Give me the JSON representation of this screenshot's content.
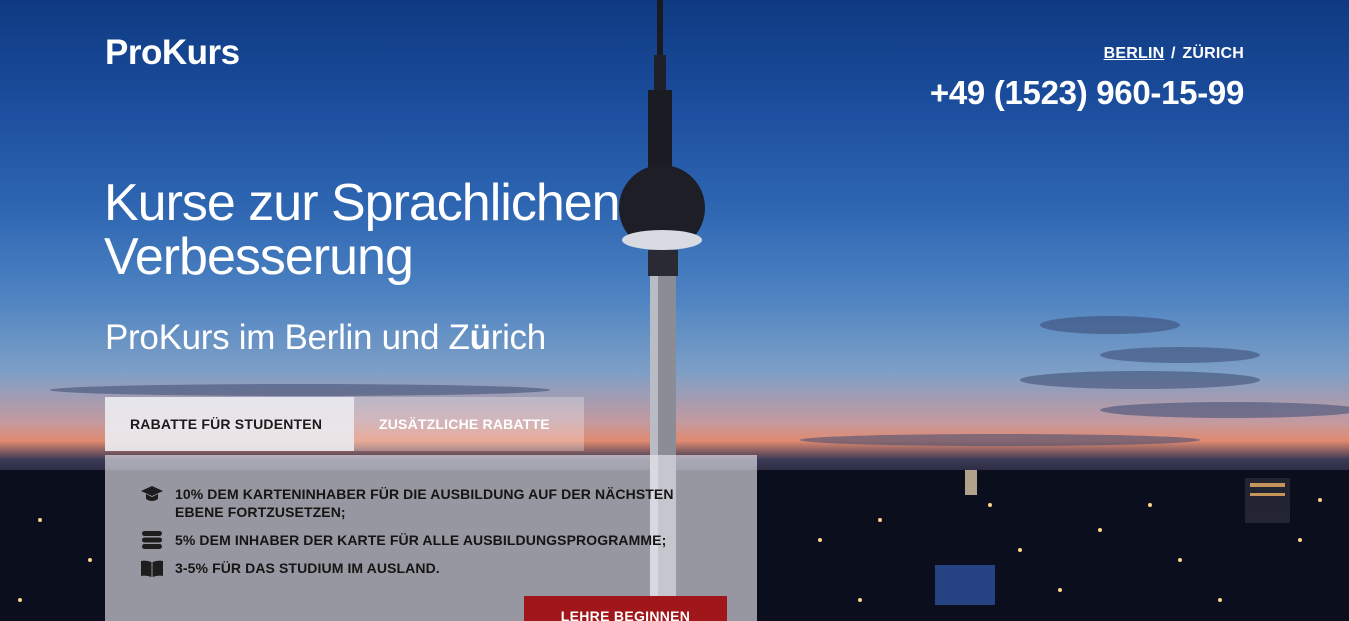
{
  "brand": {
    "logo_text": "ProKurs"
  },
  "header": {
    "cities": [
      {
        "label": "BERLIN",
        "active": true
      },
      {
        "label": "ZÜRICH",
        "active": false
      }
    ],
    "separator": "/",
    "phone": "+49 (1523) 960-15-99"
  },
  "hero": {
    "title": "Kurse zur Sprachlichen Verbesserung",
    "subtitle_prefix": "ProKurs im Berlin und Z",
    "subtitle_bold": "ü",
    "subtitle_suffix": "rich"
  },
  "tabs": [
    {
      "label": "RABATTE FÜR STUDENTEN",
      "active": true
    },
    {
      "label": "ZUSÄTZLICHE RABATTE",
      "active": false
    }
  ],
  "discounts": [
    {
      "icon": "graduation-cap-icon",
      "text": "10% DEM KARTENINHABER FÜR DIE AUSBILDUNG AUF DER NÄCHSTEN EBENE FORTZUSETZEN;"
    },
    {
      "icon": "database-stack-icon",
      "text": "5% DEM INHABER DER KARTE FÜR ALLE AUSBILDUNGSPROGRAMME;"
    },
    {
      "icon": "open-book-icon",
      "text": "3-5% FÜR DAS STUDIUM IM AUSLAND."
    }
  ],
  "cta": {
    "label": "LEHRE BEGINNEN"
  },
  "colors": {
    "accent": "#a0161a",
    "tab_active_bg": "#ebebf0"
  }
}
